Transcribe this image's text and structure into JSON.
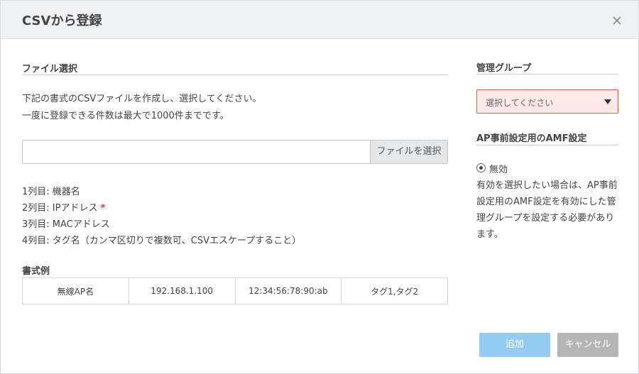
{
  "dialog": {
    "title": "CSVから登録",
    "close_icon": "close-icon"
  },
  "file_section": {
    "title": "ファイル選択",
    "instructions": [
      "下記の書式のCSVファイルを作成し、選択してください。",
      "一度に登録できる件数は最大で1000件までです。"
    ],
    "file_input_value": "",
    "choose_button_label": "ファイルを選択",
    "columns": [
      "1列目: 機器名",
      "2列目: IPアドレス",
      "3列目: MACアドレス",
      "4列目: タグ名（カンマ区切りで複数可、CSVエスケープすること）"
    ],
    "required_mark": "*",
    "example_title": "書式例",
    "example_row": [
      "無線AP名",
      "192.168.1.100",
      "12:34:56:78:90:ab",
      "タグ1,タグ2"
    ]
  },
  "group_section": {
    "title": "管理グループ",
    "select_placeholder": "選択してください"
  },
  "amf_section": {
    "title": "AP事前設定用のAMF設定",
    "radio_label": "無効",
    "radio_checked": true,
    "note": "有効を選択したい場合は、AP事前設定用のAMF設定を有効にした管理グループを設定する必要があります。"
  },
  "footer": {
    "add_label": "追加",
    "cancel_label": "キャンセル"
  },
  "colors": {
    "header_bg": "#f0f1f3",
    "select_error_bg": "#fde9e8",
    "select_error_border": "#e35a4f",
    "required": "#e03c31",
    "add_button": "#93cbf3",
    "cancel_button": "#b5b5b5"
  }
}
